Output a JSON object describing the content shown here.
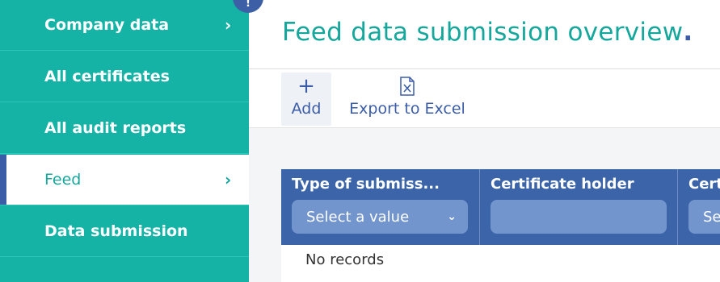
{
  "sidebar": {
    "items": [
      {
        "label": "Company data",
        "chevron": "›",
        "active": false
      },
      {
        "label": "All certificates",
        "active": false
      },
      {
        "label": "All audit reports",
        "active": false
      },
      {
        "label": "Feed",
        "chevron": "›",
        "active": true
      },
      {
        "label": "Data submission",
        "active": false
      }
    ],
    "notification_badge": "!"
  },
  "main": {
    "title": "Feed data submission overview",
    "title_dot": ".",
    "toolbar": {
      "add_icon": "+",
      "add_label": "Add",
      "export_icon": "excel-file-icon",
      "export_label": "Export to Excel"
    },
    "grid": {
      "columns": [
        {
          "header": "Type of submiss...",
          "filter_placeholder": "Select a value",
          "filter_chevron": "⌄"
        },
        {
          "header": "Certificate holder"
        },
        {
          "header": "Cert",
          "filter_placeholder": "Se"
        }
      ],
      "empty_text": "No records"
    }
  },
  "colors": {
    "sidebar": "#15b3a6",
    "accent_blue": "#3c64a8",
    "title": "#15a79b"
  }
}
